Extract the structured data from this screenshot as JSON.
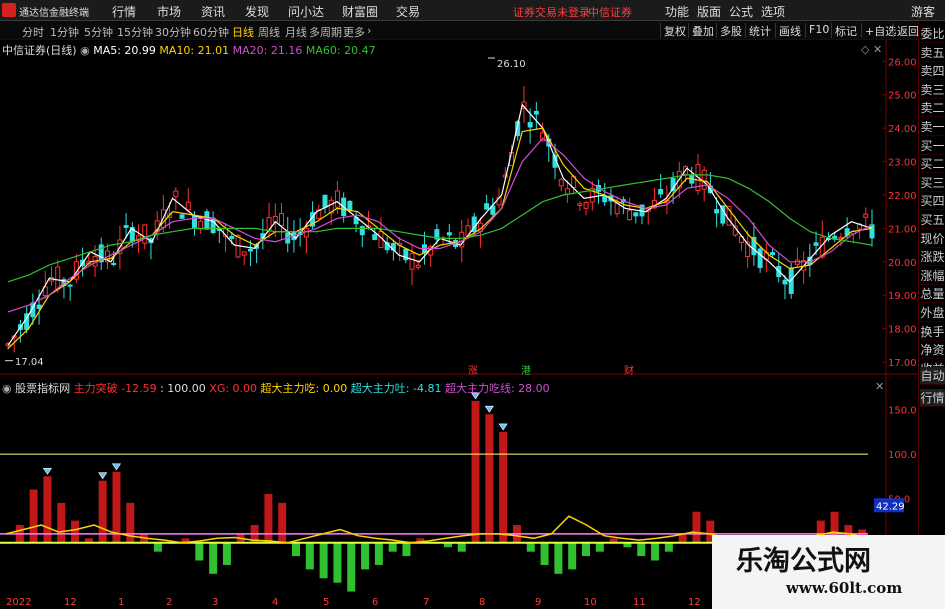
{
  "menubar": {
    "app_name": "通达信金融终端",
    "items": [
      "行情",
      "市场",
      "资讯",
      "发现",
      "问小达",
      "财富圈",
      "交易"
    ],
    "warning": "证券交易未登录",
    "broker": "中信证券",
    "right_items": [
      "功能",
      "版面",
      "公式",
      "选项"
    ],
    "guest": "游客"
  },
  "periodbar": {
    "items": [
      "分时",
      "1分钟",
      "5分钟",
      "15分钟",
      "30分钟",
      "60分钟",
      "日线",
      "周线",
      "月线",
      "多周期",
      "更多"
    ],
    "active": "日线",
    "right_buttons": [
      "复权",
      "叠加",
      "多股",
      "统计",
      "画线",
      "F10",
      "标记",
      "+自选",
      "返回"
    ]
  },
  "ma_header": {
    "stock": "中信证券(日线)",
    "ma5": "MA5: 20.99",
    "ma10": "MA10: 21.01",
    "ma20": "MA20: 21.16",
    "ma60": "MA60: 20.47"
  },
  "indicator_header": {
    "name": "股票指标网",
    "l1": "主力突破",
    "v1": "-12.59",
    "v2": "100.00",
    "l3": "XG:",
    "v3": "0.00",
    "l4": "超大主力吃:",
    "v4": "0.00",
    "l5": "超大主力吐:",
    "v5": "-4.81",
    "l6": "超大主力吃线:",
    "v6": "28.00"
  },
  "price_axis": [
    "26.00",
    "25.00",
    "24.00",
    "23.00",
    "22.00",
    "21.00",
    "20.00",
    "19.00",
    "18.00",
    "17.00"
  ],
  "ind_axis": [
    "150.0",
    "100.0",
    "50.0"
  ],
  "ind_value_box": "42.29",
  "annotations": {
    "high": "26.10",
    "low": "17.04",
    "marks": [
      "涨",
      "港",
      "财"
    ]
  },
  "date_labels": [
    "2022年",
    "12",
    "1",
    "2",
    "3",
    "4",
    "5",
    "6",
    "7",
    "8",
    "9",
    "10",
    "11",
    "12"
  ],
  "sidepanel": [
    "委比",
    "卖五",
    "卖四",
    "卖三",
    "卖二",
    "卖一",
    "买一",
    "买二",
    "买三",
    "买四",
    "买五",
    "现价",
    "涨跌",
    "涨幅",
    "总量",
    "外盘",
    "换手",
    "净资",
    "收益",
    "自动",
    "行情"
  ],
  "watermark": {
    "title": "乐淘公式网",
    "url": "www.60lt.com"
  },
  "colors": {
    "ma5": "#ffffff",
    "ma10": "#ffd200",
    "ma20": "#d050d0",
    "ma60": "#30c030",
    "up": "#ff3030",
    "down": "#30e0e0",
    "warning": "#ff3c3c"
  },
  "chart_data": [
    {
      "type": "line",
      "title": "中信证券(日线)",
      "ylim": [
        17.0,
        26.1
      ],
      "series": [
        {
          "name": "MA5",
          "values": [
            17.5,
            18.4,
            19.5,
            19.4,
            20.3,
            20.0,
            21.0,
            20.6,
            21.9,
            21.4,
            21.2,
            20.5,
            20.4,
            21.2,
            20.7,
            21.5,
            21.8,
            21.3,
            20.8,
            20.2,
            20.0,
            20.7,
            20.5,
            21.3,
            22.0,
            24.7,
            24.0,
            22.5,
            21.9,
            22.0,
            21.6,
            21.5,
            21.9,
            22.8,
            22.3,
            21.3,
            20.5,
            20.0,
            19.4,
            20.1,
            20.8,
            21.2,
            21.0
          ]
        },
        {
          "name": "MA10",
          "values": [
            17.4,
            18.0,
            19.0,
            19.4,
            20.0,
            20.1,
            20.6,
            20.8,
            21.5,
            21.4,
            21.3,
            20.8,
            20.5,
            20.9,
            20.9,
            21.2,
            21.6,
            21.5,
            21.0,
            20.5,
            20.2,
            20.5,
            20.6,
            21.0,
            21.6,
            23.9,
            24.0,
            22.9,
            22.2,
            22.0,
            21.7,
            21.6,
            21.8,
            22.5,
            22.4,
            21.6,
            20.8,
            20.2,
            19.8,
            19.9,
            20.4,
            20.9,
            21.0
          ]
        },
        {
          "name": "MA20",
          "values": [
            18.5,
            18.7,
            19.0,
            19.5,
            19.9,
            20.2,
            20.5,
            20.8,
            21.2,
            21.3,
            21.3,
            21.0,
            20.7,
            20.6,
            20.8,
            21.0,
            21.3,
            21.4,
            21.2,
            20.7,
            20.4,
            20.4,
            20.6,
            20.9,
            21.6,
            23.0,
            23.7,
            23.2,
            22.5,
            22.1,
            21.8,
            21.6,
            21.7,
            22.2,
            22.3,
            21.9,
            21.3,
            20.5,
            20.0,
            20.0,
            20.3,
            20.8,
            21.1
          ]
        },
        {
          "name": "MA60",
          "values": [
            19.4,
            19.6,
            19.9,
            20.1,
            20.3,
            20.5,
            20.6,
            20.8,
            20.9,
            21.0,
            21.0,
            21.0,
            21.0,
            20.9,
            20.9,
            20.9,
            21.0,
            21.0,
            21.0,
            20.9,
            20.8,
            20.7,
            20.7,
            20.8,
            21.0,
            21.4,
            21.8,
            22.0,
            22.1,
            22.2,
            22.3,
            22.4,
            22.5,
            22.6,
            22.6,
            22.5,
            22.2,
            21.8,
            21.3,
            20.9,
            20.7,
            20.6,
            20.5
          ]
        }
      ]
    },
    {
      "type": "bar",
      "title": "股票指标网",
      "ylim": [
        -60,
        170
      ],
      "levels": [
        100,
        10,
        0
      ],
      "series": [
        {
          "name": "主力突破",
          "values": [
            0,
            20,
            60,
            75,
            45,
            25,
            5,
            70,
            80,
            45,
            10,
            -10,
            0,
            5,
            -20,
            -35,
            -25,
            10,
            20,
            55,
            45,
            -15,
            -30,
            -40,
            -45,
            -55,
            -30,
            -25,
            -10,
            -15,
            5,
            0,
            -5,
            -10,
            160,
            145,
            125,
            20,
            -10,
            -25,
            -35,
            -30,
            -15,
            -10,
            5,
            -5,
            -15,
            -20,
            -10,
            10,
            35,
            25,
            -5,
            -20,
            -35,
            -40,
            -45,
            -50,
            -40,
            25,
            35,
            20,
            15,
            -10
          ]
        },
        {
          "name": "超大主力吃线",
          "values": [
            10,
            15,
            20,
            12,
            15,
            20,
            12,
            8,
            5,
            3,
            0,
            2,
            5,
            6,
            3,
            2,
            0,
            5,
            10,
            15,
            8,
            5,
            3,
            0,
            2,
            5,
            8,
            10,
            10,
            8,
            5,
            10,
            30,
            20,
            8,
            5,
            3,
            5,
            8,
            12,
            10,
            5,
            2,
            0,
            2,
            5,
            8,
            12,
            10,
            5
          ]
        }
      ]
    }
  ]
}
